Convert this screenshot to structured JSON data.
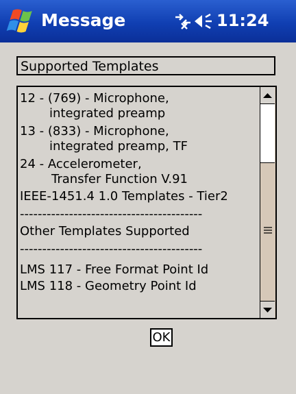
{
  "window": {
    "title": "Message",
    "clock": "11:24",
    "start_icon": "windows-flag-icon",
    "network_icon": "network-disconnected-icon",
    "volume_icon": "speaker-icon"
  },
  "dialog": {
    "header": "Supported Templates",
    "list_lines": [
      "12 - (769) - Microphone,",
      "integrated preamp",
      "13 - (833) - Microphone,",
      "integrated preamp, TF",
      "24 - Accelerometer,",
      "Transfer Function V.91",
      "IEEE-1451.4 1.0 Templates - Tier2",
      "-----------------------------------------",
      "Other Templates Supported",
      "-----------------------------------------",
      "LMS 117 - Free Format Point Id",
      "LMS 118 - Geometry Point Id"
    ],
    "ok_label": "OK"
  },
  "colors": {
    "titlebar": "#103fb2",
    "background": "#d6d3ce",
    "scroll_track": "#d6c8b8"
  }
}
